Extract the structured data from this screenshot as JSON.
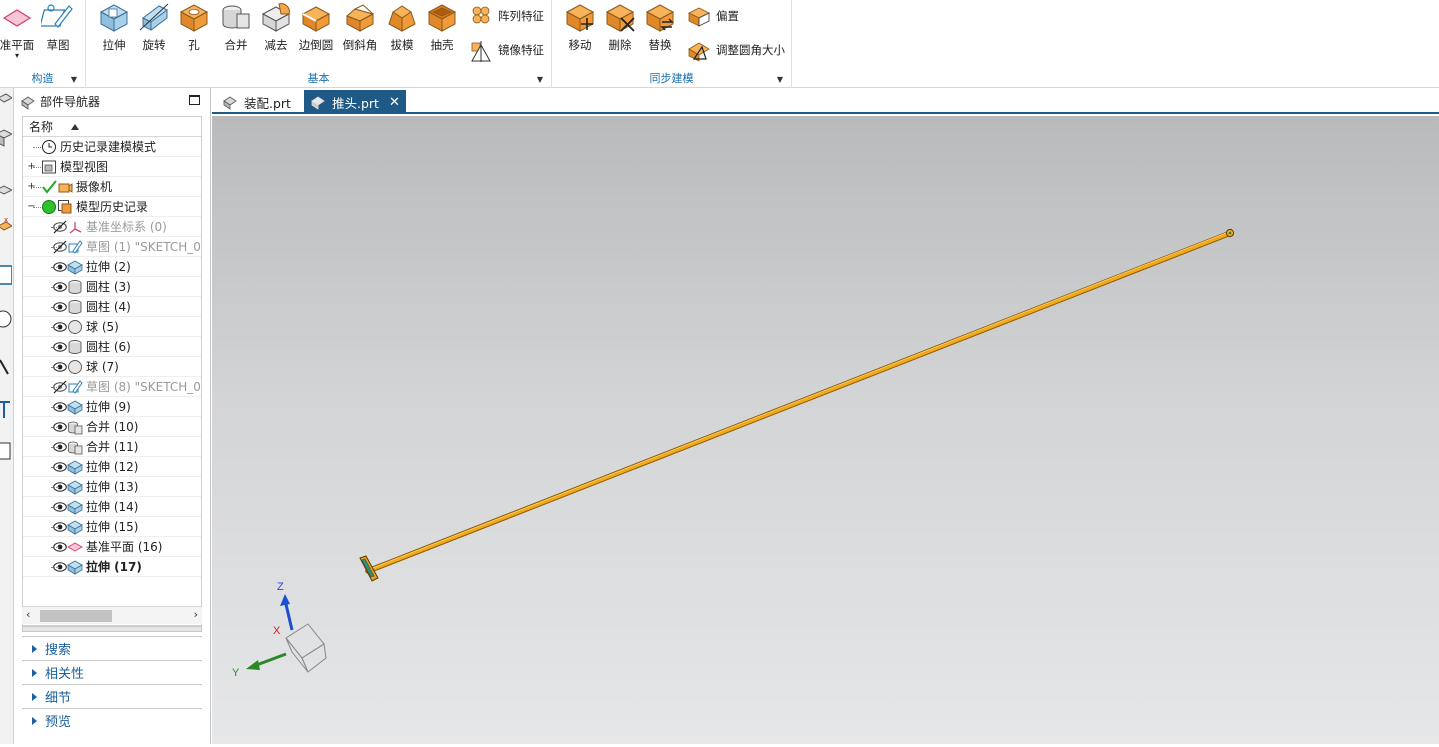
{
  "ribbon": {
    "construct_group": {
      "label": "构造",
      "items": [
        {
          "label": "准平面",
          "icon": "datum-plane-icon"
        },
        {
          "label": "草图",
          "icon": "sketch-icon"
        }
      ]
    },
    "basic_group": {
      "label": "基本",
      "items": [
        {
          "label": "拉伸",
          "icon": "extrude-icon"
        },
        {
          "label": "旋转",
          "icon": "revolve-icon"
        },
        {
          "label": "孔",
          "icon": "hole-icon"
        },
        {
          "label": "合并",
          "icon": "unite-icon"
        },
        {
          "label": "减去",
          "icon": "subtract-icon"
        },
        {
          "label": "边倒圆",
          "icon": "edge-blend-icon"
        },
        {
          "label": "倒斜角",
          "icon": "chamfer-icon"
        },
        {
          "label": "拔模",
          "icon": "draft-icon"
        },
        {
          "label": "抽壳",
          "icon": "shell-icon"
        }
      ],
      "small_items": [
        {
          "label": "阵列特征",
          "icon": "pattern-feature-icon"
        },
        {
          "label": "镜像特征",
          "icon": "mirror-feature-icon"
        }
      ]
    },
    "sync_group": {
      "label": "同步建模",
      "items": [
        {
          "label": "移动",
          "icon": "move-face-icon"
        },
        {
          "label": "删除",
          "icon": "delete-face-icon"
        },
        {
          "label": "替换",
          "icon": "replace-face-icon"
        }
      ],
      "small_items": [
        {
          "label": "偏置",
          "icon": "offset-region-icon"
        },
        {
          "label": "调整圆角大小",
          "icon": "resize-blend-icon"
        }
      ]
    }
  },
  "navigator": {
    "title": "部件导航器",
    "column_header": "名称",
    "rows": [
      {
        "label": "历史记录建模模式",
        "icon": "clock-icon",
        "state": "normal"
      },
      {
        "label": "模型视图",
        "icon": "model-view-icon",
        "state": "normal",
        "expander": "+"
      },
      {
        "label": "摄像机",
        "icon": "camera-icon",
        "state": "normal",
        "expander": "+"
      },
      {
        "label": "模型历史记录",
        "icon": "model-history-icon",
        "state": "normal",
        "expander": "−"
      },
      {
        "label": "基准坐标系 (0)",
        "icon": "datum-csys-icon",
        "state": "hidden"
      },
      {
        "label": "草图 (1) \"SKETCH_0",
        "icon": "sketch-icon",
        "state": "hidden"
      },
      {
        "label": "拉伸 (2)",
        "icon": "extrude-icon",
        "state": "visible"
      },
      {
        "label": "圆柱 (3)",
        "icon": "cylinder-icon",
        "state": "visible"
      },
      {
        "label": "圆柱 (4)",
        "icon": "cylinder-icon",
        "state": "visible"
      },
      {
        "label": "球 (5)",
        "icon": "sphere-icon",
        "state": "visible"
      },
      {
        "label": "圆柱 (6)",
        "icon": "cylinder-icon",
        "state": "visible"
      },
      {
        "label": "球 (7)",
        "icon": "sphere-icon",
        "state": "visible"
      },
      {
        "label": "草图 (8) \"SKETCH_0",
        "icon": "sketch-icon",
        "state": "hidden"
      },
      {
        "label": "拉伸 (9)",
        "icon": "extrude-icon",
        "state": "visible"
      },
      {
        "label": "合并 (10)",
        "icon": "unite-icon",
        "state": "visible"
      },
      {
        "label": "合并 (11)",
        "icon": "unite-icon",
        "state": "visible"
      },
      {
        "label": "拉伸 (12)",
        "icon": "extrude-icon",
        "state": "visible"
      },
      {
        "label": "拉伸 (13)",
        "icon": "extrude-icon",
        "state": "visible"
      },
      {
        "label": "拉伸 (14)",
        "icon": "extrude-icon",
        "state": "visible"
      },
      {
        "label": "拉伸 (15)",
        "icon": "extrude-icon",
        "state": "visible"
      },
      {
        "label": "基准平面 (16)",
        "icon": "datum-plane-icon",
        "state": "visible"
      },
      {
        "label": "拉伸 (17)",
        "icon": "extrude-icon",
        "state": "current"
      }
    ],
    "panels": [
      "搜索",
      "相关性",
      "细节",
      "预览"
    ]
  },
  "tabs": [
    {
      "label": "装配.prt",
      "active": false
    },
    {
      "label": "推头.prt",
      "active": true
    }
  ],
  "triad": {
    "x_label": "X",
    "y_label": "Y",
    "z_label": "Z"
  },
  "colors": {
    "accent": "#1e5a85",
    "part_orange": "#e8a21a",
    "ribbon_group_label": "#1a6fb0",
    "axis_x": "#d02020",
    "axis_y": "#2a8a2a",
    "axis_z": "#1a4fd0"
  }
}
